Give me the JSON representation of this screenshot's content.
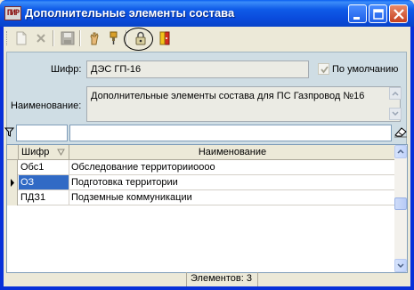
{
  "window": {
    "title": "Дополнительные элементы состава",
    "app_icon_text": "ПИР"
  },
  "toolbar": {
    "buttons": [
      {
        "icon": "new-document-icon",
        "enabled": false
      },
      {
        "icon": "delete-icon",
        "enabled": false
      },
      {
        "icon": "save-icon",
        "enabled": false
      },
      {
        "icon": "hand-icon",
        "enabled": true
      },
      {
        "icon": "pin-icon",
        "enabled": true
      },
      {
        "icon": "lock-icon",
        "enabled": true
      },
      {
        "icon": "exit-door-icon",
        "enabled": true
      }
    ]
  },
  "form": {
    "code_label": "Шифр:",
    "code_value": "ДЭС ГП-16",
    "default_label": "По умолчанию",
    "default_checked": true,
    "name_label": "Наименование:",
    "name_value": "Дополнительные элементы состава для ПС Газпровод  №16"
  },
  "grid": {
    "columns": [
      "Шифр",
      "Наименование"
    ],
    "rows": [
      {
        "code": "Обс1",
        "name": "Обследование территорииоооо"
      },
      {
        "code": "ОЗ",
        "name": "Подготовка территории",
        "selected": true
      },
      {
        "code": "ПДЗ1",
        "name": "Подземные коммуникации"
      }
    ]
  },
  "status": {
    "count_text": "Элементов: 3"
  },
  "colors": {
    "title_blue": "#0a4bdc",
    "panel_bg": "#cfdde4",
    "selection": "#316ac5"
  }
}
